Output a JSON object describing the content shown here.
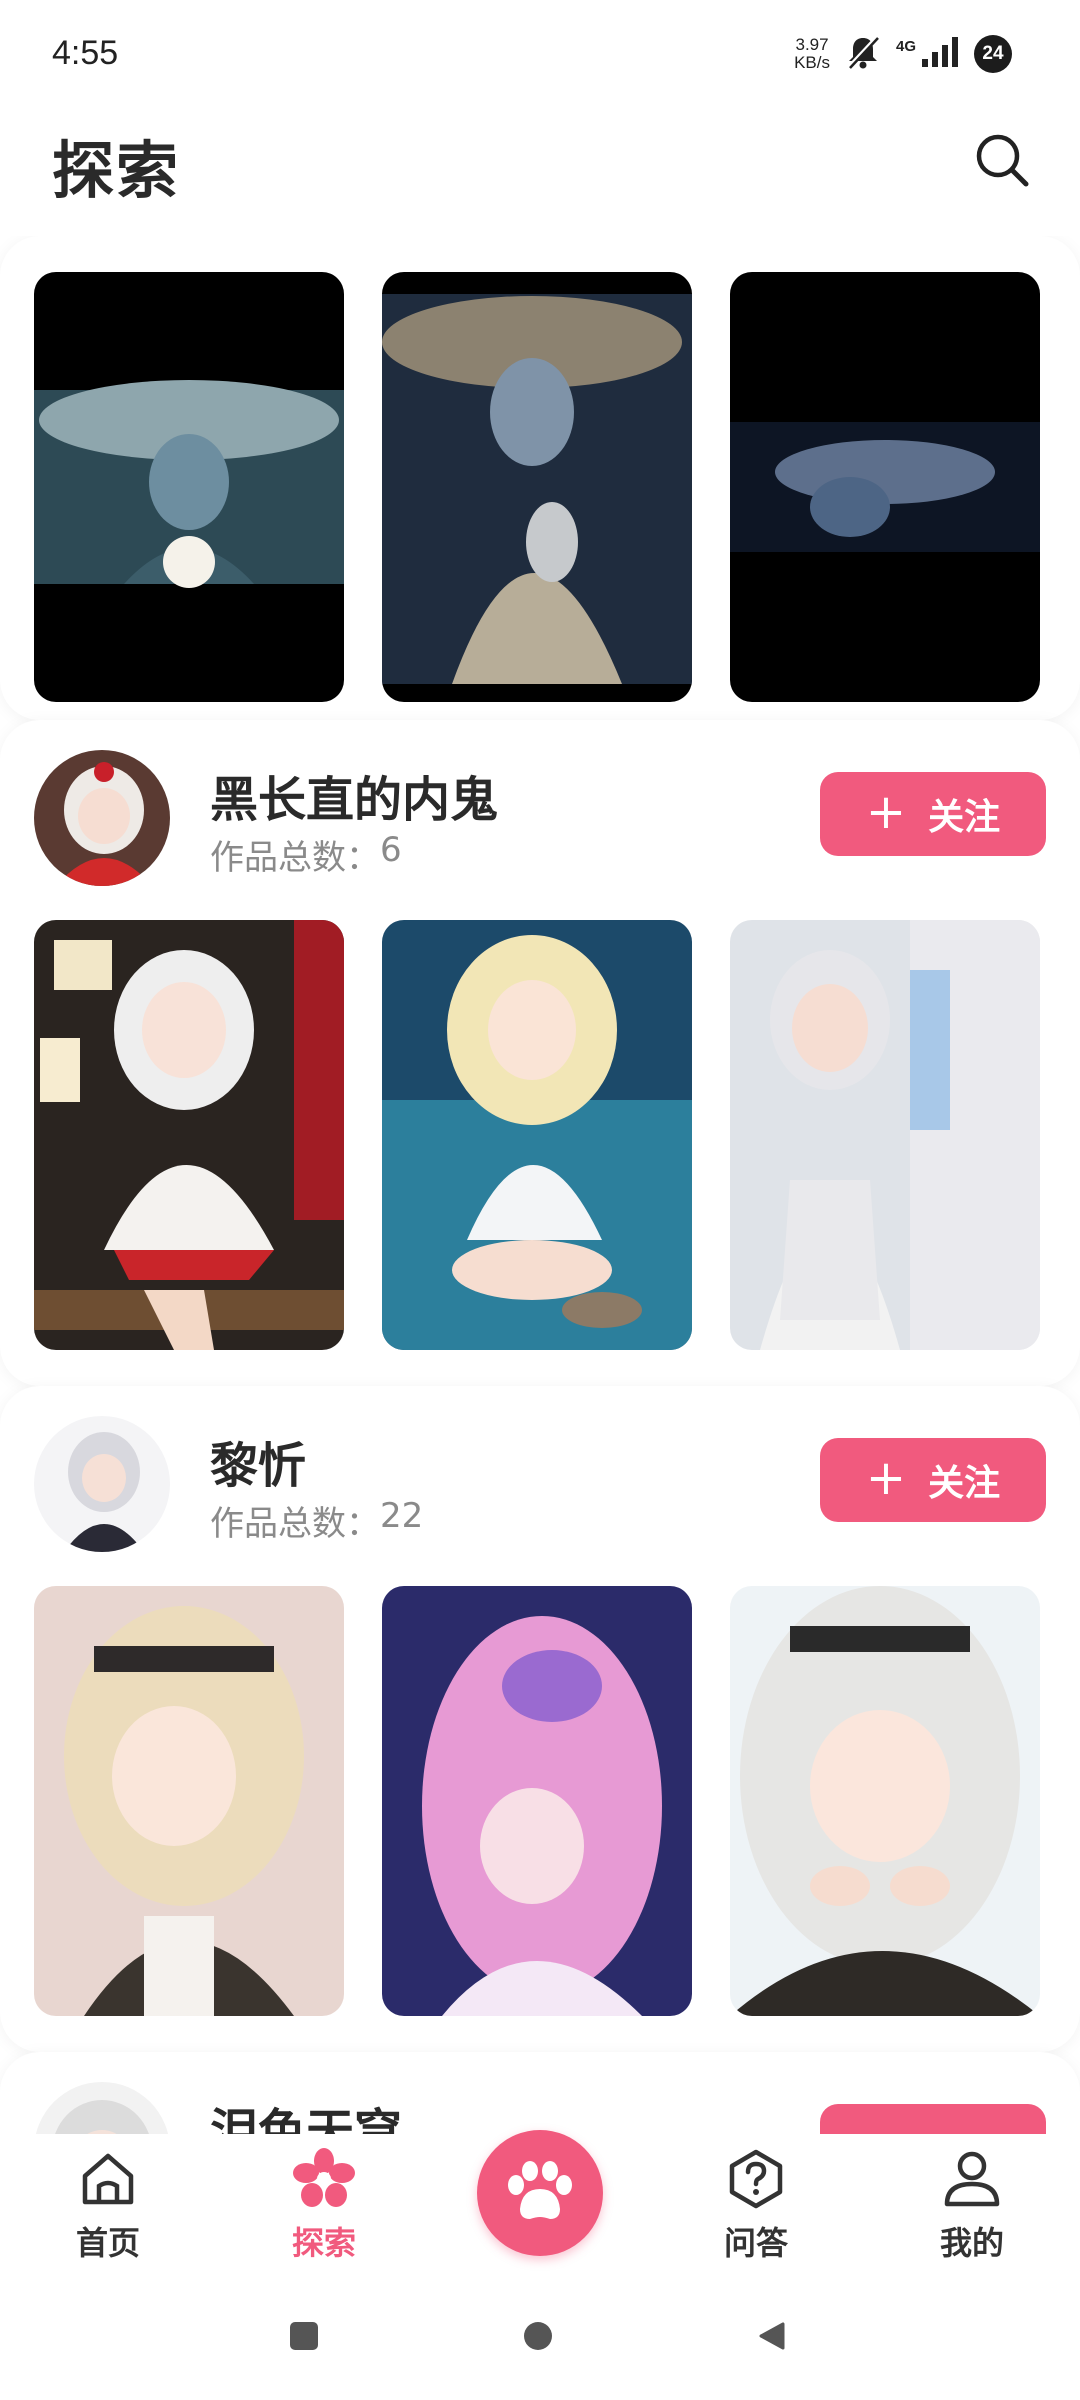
{
  "status_bar": {
    "time": "4:55",
    "net_speed_value": "3.97",
    "net_speed_unit": "KB/s",
    "network_type": "4G",
    "battery": "24"
  },
  "header": {
    "title": "探索"
  },
  "featured": {
    "items": [
      {
        "icon": "artwork-thumbnail"
      },
      {
        "icon": "artwork-thumbnail"
      },
      {
        "icon": "artwork-thumbnail"
      }
    ]
  },
  "authors": [
    {
      "name": "黑长直的内鬼",
      "works_label": "作品总数：",
      "works_count": "6",
      "follow_label": "关注"
    },
    {
      "name": "黎忻",
      "works_label": "作品总数：",
      "works_count": "22",
      "follow_label": "关注"
    },
    {
      "name": "泪色天穹",
      "works_label": "",
      "works_count": "",
      "follow_label": ""
    }
  ],
  "bottom_nav": {
    "items": [
      {
        "label": "首页",
        "icon": "home-icon"
      },
      {
        "label": "探索",
        "icon": "explore-flower-icon",
        "active": true
      },
      {
        "label": "",
        "icon": "paw-icon"
      },
      {
        "label": "问答",
        "icon": "question-icon"
      },
      {
        "label": "我的",
        "icon": "profile-icon"
      }
    ]
  },
  "colors": {
    "accent": "#f15a7e",
    "text_primary": "#2a2a2a",
    "text_secondary": "#8a8a8a"
  }
}
